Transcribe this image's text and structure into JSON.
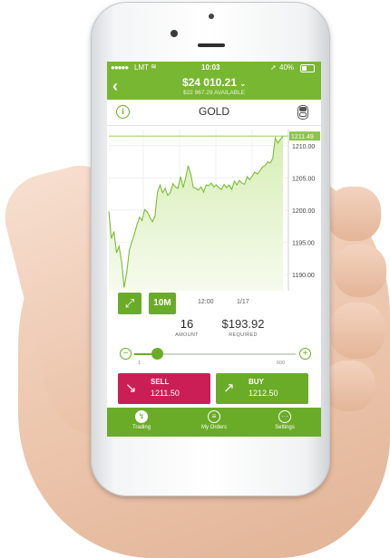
{
  "status_bar": {
    "carrier": "LMT",
    "time": "10:03",
    "battery": "40%"
  },
  "header": {
    "balance": "$24 010.21",
    "available": "$22 967.29 AVAILABLE"
  },
  "asset": {
    "name": "GOLD"
  },
  "chart_data": {
    "type": "area",
    "x_tick_labels": [
      "12:00",
      "1/17"
    ],
    "y_tick_labels": [
      "1210.00",
      "1205.00",
      "1200.00",
      "1195.00",
      "1190.00"
    ],
    "ylim": [
      1187.5,
      1212.5
    ],
    "current_label": "1211.49",
    "series": [
      {
        "values": [
          1199.8,
          1195.6,
          1196.7,
          1193.4,
          1194.4,
          1192.0,
          1188.0,
          1190.4,
          1193.8,
          1195.1,
          1196.3,
          1197.8,
          1198.9,
          1198.4,
          1200.1,
          1199.7,
          1198.9,
          1198.2,
          1199.0,
          1202.8,
          1203.9,
          1202.7,
          1203.4,
          1202.3,
          1202.7,
          1204.1,
          1203.6,
          1203.4,
          1205.2,
          1203.5,
          1205.0,
          1206.9,
          1205.5,
          1203.5,
          1203.4,
          1203.1,
          1203.6,
          1202.8,
          1203.9,
          1203.8,
          1204.2,
          1203.6,
          1203.9,
          1203.5,
          1203.2,
          1204.0,
          1203.5,
          1203.9,
          1203.2,
          1204.5,
          1203.9,
          1204.6,
          1204.2,
          1204.0,
          1205.2,
          1204.7,
          1205.3,
          1205.9,
          1205.6,
          1206.1,
          1206.7,
          1206.9,
          1207.5,
          1207.3,
          1208.0,
          1211.2,
          1210.4,
          1211.0,
          1211.49
        ]
      }
    ],
    "grid": true
  },
  "controls": {
    "expand_icon": "expand-icon",
    "timeframe": "10M"
  },
  "order": {
    "amount": "16",
    "amount_label": "AMOUNT",
    "required": "$193.92",
    "required_label": "REQUIRED",
    "slider_min": "1",
    "slider_max": "600",
    "slider_value": 16
  },
  "sell": {
    "label": "SELL",
    "price": "1211.50"
  },
  "buy": {
    "label": "BUY",
    "price": "1212.50"
  },
  "tabs": [
    {
      "label": "Trading",
      "icon": "trading-icon",
      "active": true
    },
    {
      "label": "My Orders",
      "icon": "orders-icon",
      "active": false
    },
    {
      "label": "Settings",
      "icon": "settings-icon",
      "active": false
    }
  ],
  "colors": {
    "primary": "#6aac27",
    "sell": "#cc1e56",
    "header": "#78b731",
    "area": "#e6f4cf"
  }
}
